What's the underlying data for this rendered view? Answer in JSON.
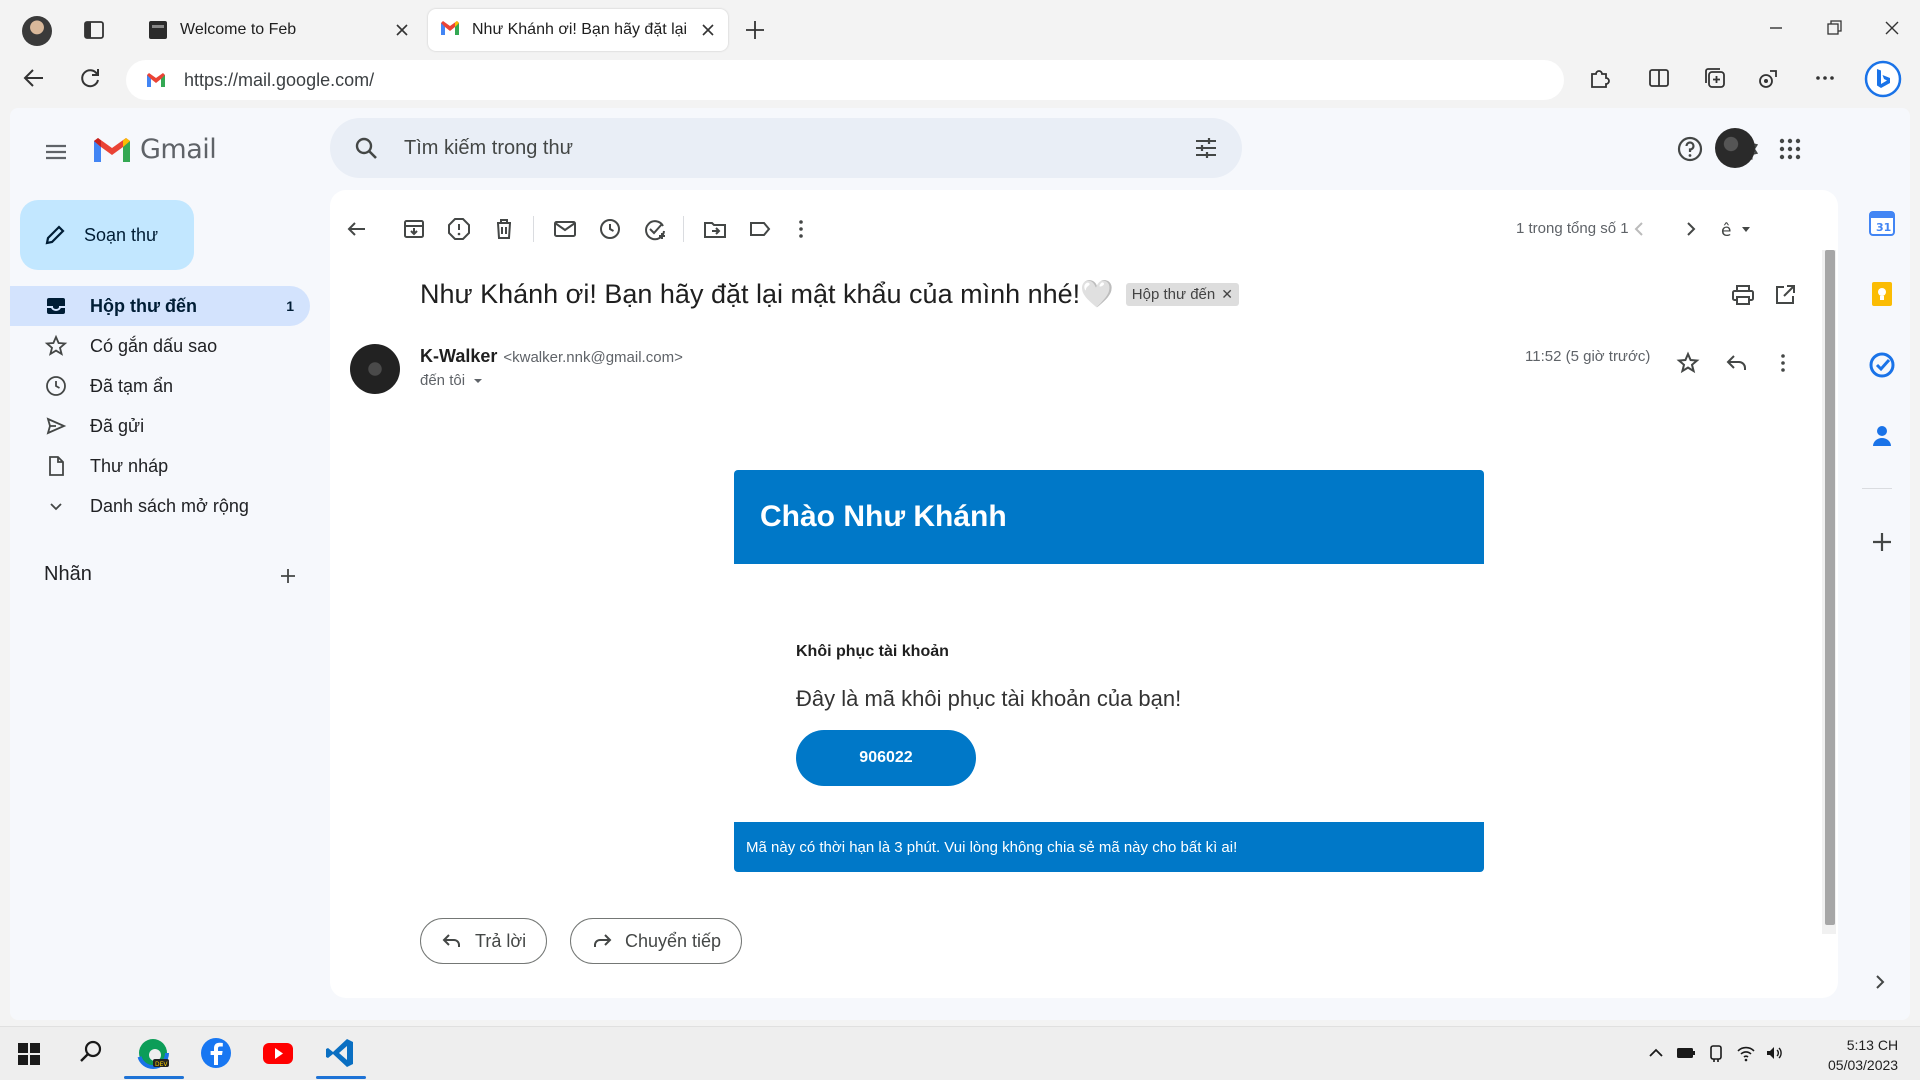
{
  "browser": {
    "tabs": [
      {
        "title": "Welcome to Feb",
        "active": false
      },
      {
        "title": "Như Khánh ơi! Bạn hãy đặt lại",
        "active": true
      }
    ],
    "url": "https://mail.google.com/"
  },
  "gmail": {
    "brand": "Gmail",
    "search_placeholder": "Tìm kiếm trong thư",
    "compose_label": "Soạn thư",
    "nav": [
      {
        "label": "Hộp thư đến",
        "count": "1",
        "icon": "inbox-icon",
        "active": true
      },
      {
        "label": "Có gắn dấu sao",
        "icon": "star-icon"
      },
      {
        "label": "Đã tạm ẩn",
        "icon": "clock-icon"
      },
      {
        "label": "Đã gửi",
        "icon": "send-icon"
      },
      {
        "label": "Thư nháp",
        "icon": "draft-icon"
      },
      {
        "label": "Danh sách mở rộng",
        "icon": "chevron-down-icon"
      }
    ],
    "labels_heading": "Nhãn",
    "pager_text": "1 trong tổng số 1",
    "email": {
      "subject": "Như Khánh ơi! Bạn hãy đặt lại mật khẩu của mình nhé!🤍",
      "label_chip": "Hộp thư đến",
      "sender_name": "K-Walker",
      "sender_email": "<kwalker.nnk@gmail.com>",
      "to_text": "đến tôi",
      "time": "11:52 (5 giờ trước)",
      "body": {
        "greeting": "Chào Như Khánh",
        "section_title": "Khôi phục tài khoản",
        "message": "Đây là mã khôi phục tài khoản của bạn!",
        "code": "906022",
        "notice": "Mã này có thời hạn là 3 phút. Vui lòng không chia sẻ mã này cho bất kì ai!"
      },
      "reply_label": "Trả lời",
      "forward_label": "Chuyển tiếp"
    }
  },
  "taskbar": {
    "time": "5:13 CH",
    "date": "05/03/2023"
  },
  "colors": {
    "email_blue": "#0078c8",
    "compose_bg": "#c2e7ff",
    "nav_active_bg": "#d3e3fd"
  }
}
